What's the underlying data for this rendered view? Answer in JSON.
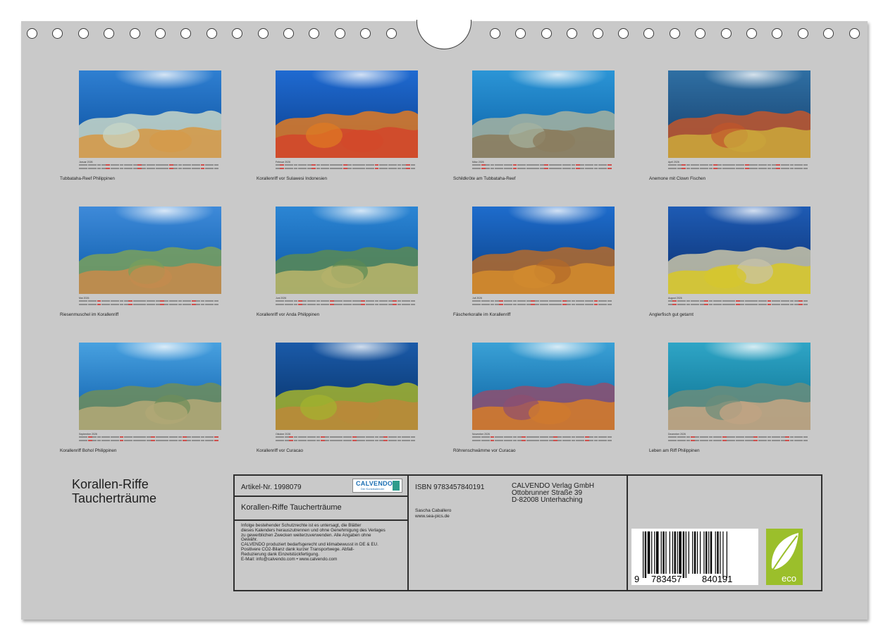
{
  "months": [
    {
      "name": "Januar 2026",
      "caption": "Tubbataha-Reef Philippinen"
    },
    {
      "name": "Februar 2026",
      "caption": "Korallenriff vor Sulawesi Indonesien"
    },
    {
      "name": "März 2026",
      "caption": "Schildkröte am Tubbataha-Reef"
    },
    {
      "name": "April 2026",
      "caption": "Anemone mit Clown Fischen"
    },
    {
      "name": "Mai 2026",
      "caption": "Riesenmuschel im Korallenriff"
    },
    {
      "name": "Juni 2026",
      "caption": "Korallenriff vor Anda Philippinen"
    },
    {
      "name": "Juli 2026",
      "caption": "Fäscherkoralle im Korallenriff"
    },
    {
      "name": "August 2026",
      "caption": "Anglerfisch gut getarnt"
    },
    {
      "name": "September 2026",
      "caption": "Korallenriff Bohol Philippinen"
    },
    {
      "name": "Oktober 2026",
      "caption": "Korallenriff vor Curacao"
    },
    {
      "name": "November 2026",
      "caption": "Röhrenschwämme vor Curacao"
    },
    {
      "name": "Dezember 2026",
      "caption": "Leben am Riff Philippinen"
    }
  ],
  "title": {
    "line1": "Korallen-Riffe",
    "line2": "Taucherträume"
  },
  "info": {
    "article": "Artikel-Nr. 1998079",
    "logo_text": "CALVENDO",
    "logo_sub": "Der Kunstkalender",
    "product_title": "Korallen-Riffe Taucherträume",
    "legal": [
      "Infolge bestehender Schutzrechte ist es untersagt, die Blätter",
      "dieses Kalenders herauszutrennen und ohne Genehmigung des Verlages",
      "zu gewerblichen Zwecken weiterzuverwenden. Alle Angaben ohne",
      "Gewähr.",
      "CALVENDO produziert bedarfsgerecht und klimabewusst in DE & EU.",
      "Positivere CO2-Bilanz dank kurzer Transportwege. Abfall-",
      "Reduzierung dank Einzelstückfertigung.",
      "E-Mail: info@calvendo.com • www.calvendo.com"
    ],
    "isbn": "ISBN 9783457840191",
    "publisher": [
      "CALVENDO Verlag GmbH",
      "Ottobrunner Straße 39",
      "D-82008 Unterhaching"
    ],
    "author": "Sascha Caballero",
    "website": "www.sea-pics.de",
    "barcode_digits": [
      "9",
      "783457",
      "840191"
    ],
    "eco_label": "eco"
  },
  "colors": {
    "sheet": "#c9c9c9",
    "border": "#2f2f2f",
    "ocean": "#0a4f9e"
  }
}
